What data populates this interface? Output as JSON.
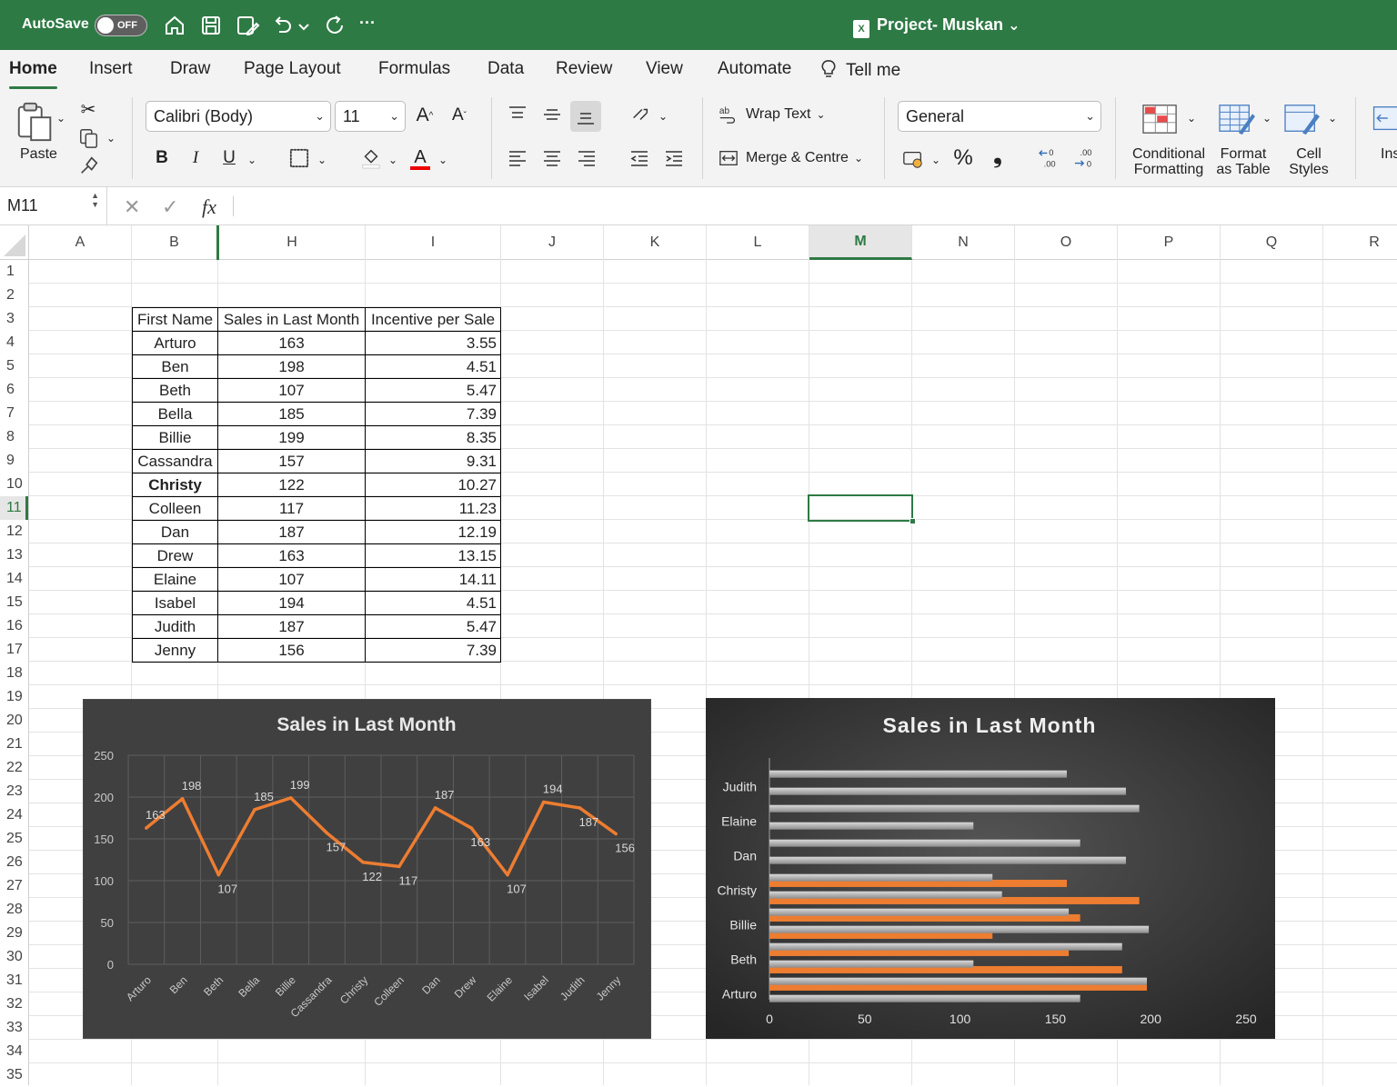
{
  "titlebar": {
    "autosave": "AutoSave",
    "toggle": "OFF",
    "doc_title": "Project- Muskan",
    "chevron": "⌄",
    "more": "···"
  },
  "tabs": [
    "Home",
    "Insert",
    "Draw",
    "Page Layout",
    "Formulas",
    "Data",
    "Review",
    "View",
    "Automate",
    "Tell me"
  ],
  "ribbon": {
    "paste": "Paste",
    "font_name": "Calibri (Body)",
    "font_size": "11",
    "bold": "B",
    "italic": "I",
    "underline": "U",
    "wrap_text": "Wrap Text",
    "merge": "Merge & Centre",
    "number_format": "General",
    "percent": "%",
    "comma": "❟",
    "cond_fmt_1": "Conditional",
    "cond_fmt_2": "Formatting",
    "fmt_table_1": "Format",
    "fmt_table_2": "as Table",
    "cell_styles_1": "Cell",
    "cell_styles_2": "Styles",
    "insert_partial": "Ins"
  },
  "formula_bar": {
    "cell_ref": "M11",
    "fx": "fx",
    "cancel": "✕",
    "enter": "✓"
  },
  "columns": [
    "A",
    "B",
    "H",
    "I",
    "J",
    "K",
    "L",
    "M",
    "N",
    "O",
    "P",
    "Q",
    "R"
  ],
  "selected_column": "M",
  "selected_row": "11",
  "table": {
    "headers": [
      "First Name",
      "Sales in Last Month",
      "Incentive per Sale"
    ],
    "rows": [
      [
        "Arturo",
        "163",
        "3.55"
      ],
      [
        "Ben",
        "198",
        "4.51"
      ],
      [
        "Beth",
        "107",
        "5.47"
      ],
      [
        "Bella",
        "185",
        "7.39"
      ],
      [
        "Billie",
        "199",
        "8.35"
      ],
      [
        "Cassandra",
        "157",
        "9.31"
      ],
      [
        "Christy",
        "122",
        "10.27"
      ],
      [
        "Colleen",
        "117",
        "11.23"
      ],
      [
        "Dan",
        "187",
        "12.19"
      ],
      [
        "Drew",
        "163",
        "13.15"
      ],
      [
        "Elaine",
        "107",
        "14.11"
      ],
      [
        "Isabel",
        "194",
        "4.51"
      ],
      [
        "Judith",
        "187",
        "5.47"
      ],
      [
        "Jenny",
        "156",
        "7.39"
      ]
    ]
  },
  "chart_data": [
    {
      "type": "line",
      "title": "Sales in Last Month",
      "categories": [
        "Arturo",
        "Ben",
        "Beth",
        "Bella",
        "Billie",
        "Cassandra",
        "Christy",
        "Colleen",
        "Dan",
        "Drew",
        "Elaine",
        "Isabel",
        "Judith",
        "Jenny"
      ],
      "values": [
        163,
        198,
        107,
        185,
        199,
        157,
        122,
        117,
        187,
        163,
        107,
        194,
        187,
        156
      ],
      "ylim": [
        0,
        250
      ],
      "yticks": [
        0,
        50,
        100,
        150,
        200,
        250
      ],
      "grid": true,
      "color": "#ed7d31",
      "background": "#404040",
      "legend": "none"
    },
    {
      "type": "bar",
      "orientation": "horizontal",
      "title": "Sales in Last Month",
      "categories": [
        "Arturo",
        "Ben",
        "Beth",
        "Bella",
        "Billie",
        "Cassandra",
        "Christy",
        "Colleen",
        "Dan",
        "Drew",
        "Elaine",
        "Isabel",
        "Judith",
        "Jenny"
      ],
      "category_labels_shown": [
        "Arturo",
        "Beth",
        "Billie",
        "Christy",
        "Dan",
        "Elaine",
        "Judith"
      ],
      "series": [
        {
          "values": [
            163,
            198,
            107,
            185,
            199,
            157,
            122,
            117,
            187,
            163,
            107,
            194,
            187,
            156
          ],
          "color": "#a6a6a6"
        },
        {
          "values": [
            198,
            185,
            157,
            117,
            163,
            194,
            156,
            null,
            null,
            null,
            null,
            null,
            null,
            null
          ],
          "color": "#ed7d31"
        }
      ],
      "xlim": [
        0,
        250
      ],
      "xticks": [
        0,
        50,
        100,
        150,
        200,
        250
      ],
      "grid": false,
      "background": "#333333",
      "legend": "none"
    }
  ]
}
